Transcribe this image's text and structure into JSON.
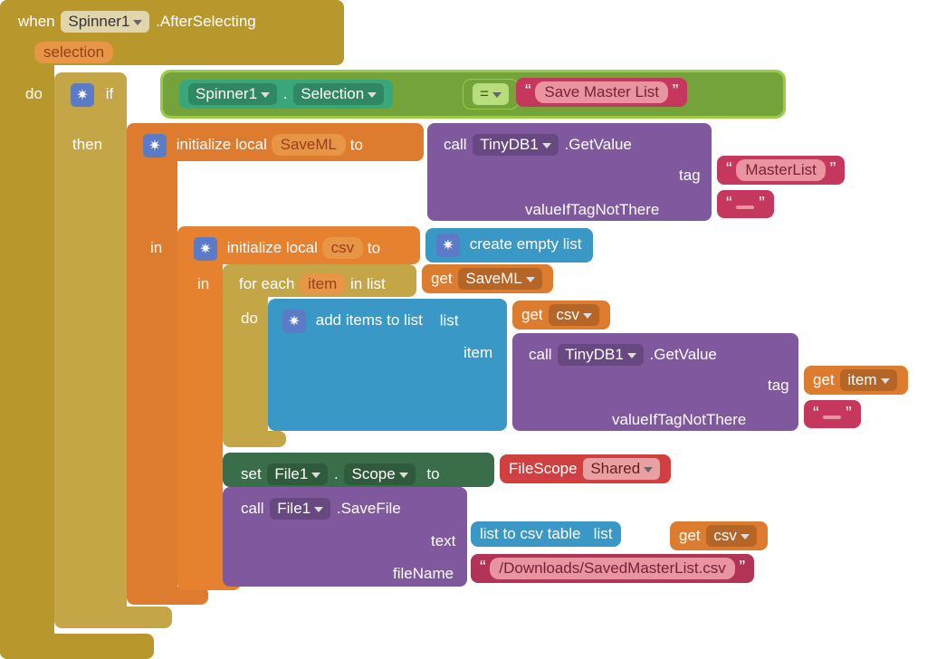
{
  "event": {
    "when": "when",
    "component": "Spinner1",
    "eventName": ".AfterSelecting",
    "param": "selection",
    "do": "do"
  },
  "if": {
    "label": "if",
    "cond": {
      "component": "Spinner1",
      "dot": ".",
      "property": "Selection",
      "op": "=",
      "value": "Save Master List"
    },
    "then": "then"
  },
  "initSaveML": {
    "label": "initialize local",
    "var": "SaveML",
    "to": "to",
    "in": "in",
    "call": {
      "call": "call",
      "component": "TinyDB1",
      "method": ".GetValue",
      "tagLabel": "tag",
      "tagValue": "MasterList",
      "vintLabel": "valueIfTagNotThere",
      "vintValue": ""
    }
  },
  "initCsv": {
    "label": "initialize local",
    "var": "csv",
    "to": "to",
    "in": "in",
    "createList": "create empty list"
  },
  "foreach": {
    "label": "for each",
    "var": "item",
    "inList": "in list",
    "get": "get",
    "getVar": "SaveML",
    "do": "do"
  },
  "addItems": {
    "label": "add items to list",
    "listLabel": "list",
    "getCsv": "csv",
    "itemLabel": "item",
    "get": "get"
  },
  "innerGetValue": {
    "call": "call",
    "component": "TinyDB1",
    "method": ".GetValue",
    "tagLabel": "tag",
    "getItem": "item",
    "vintLabel": "valueIfTagNotThere",
    "vintValue": ""
  },
  "setScope": {
    "set": "set",
    "component": "File1",
    "dot": ".",
    "property": "Scope",
    "to": "to",
    "scopeLabel": "FileScope",
    "scopeValue": "Shared"
  },
  "saveFile": {
    "call": "call",
    "component": "File1",
    "method": ".SaveFile",
    "textLabel": "text",
    "fileNameLabel": "fileName",
    "listToCsv": "list to csv table",
    "listLabel": "list",
    "getCsv": "csv",
    "fileName": "/Downloads/SavedMasterList.csv"
  },
  "common": {
    "get": "get"
  }
}
